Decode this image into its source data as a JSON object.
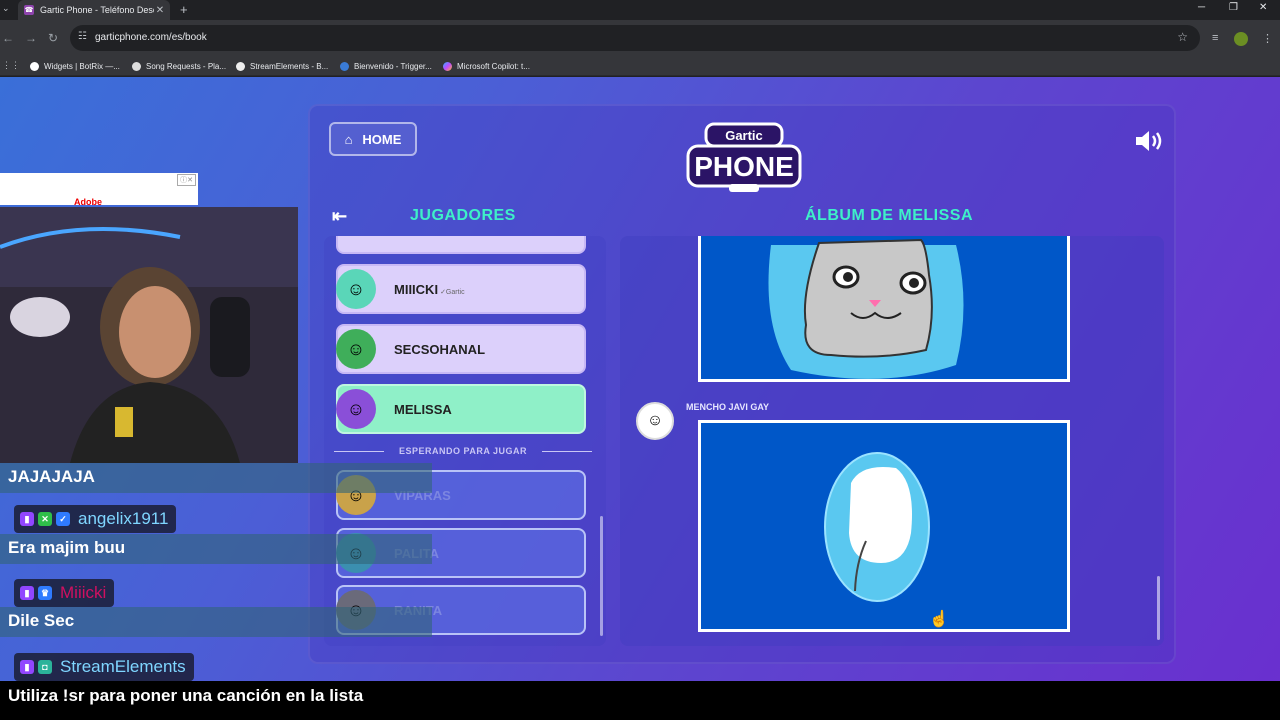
{
  "browser": {
    "tab_title": "Gartic Phone - Teléfono Descon",
    "url": "garticphone.com/es/book",
    "bookmarks": [
      "Widgets | BotRix —...",
      "Song Requests - Pla...",
      "StreamElements - B...",
      "Bienvenido - Trigger...",
      "Microsoft Copilot: t..."
    ]
  },
  "game": {
    "home_label": "HOME",
    "logo_top": "Gartic",
    "logo_bottom": "PHONE",
    "players_heading": "JUGADORES",
    "album_heading": "ÁLBUM DE MELISSA",
    "players": [
      {
        "name": "MIIICKI",
        "tag": "✓Gartic",
        "state": "active"
      },
      {
        "name": "SECSOHANAL",
        "tag": "",
        "state": "active"
      },
      {
        "name": "MELISSA",
        "tag": "",
        "state": "selected"
      }
    ],
    "waiting_label": "ESPERANDO PARA JUGAR",
    "waiting_players": [
      "VIPARAS",
      "PALITA",
      "RANITA"
    ],
    "album_author": "MENCHO JAVI GAY"
  },
  "overlay": {
    "chat": [
      {
        "type": "text",
        "text": "JAJAJAJA"
      },
      {
        "type": "user",
        "name": "angelix1911",
        "color": "#7fd6ff"
      },
      {
        "type": "text",
        "text": "Era majim buu"
      },
      {
        "type": "user",
        "name": "Miiicki",
        "color": "#d01060"
      },
      {
        "type": "text",
        "text": "Dile Sec"
      },
      {
        "type": "user",
        "name": "StreamElements",
        "color": "#7fd6ff"
      }
    ],
    "caption": "Utiliza !sr para poner una canción en la lista",
    "ad_text": "Adobe"
  },
  "colors": {
    "accent_teal": "#3ef0c8",
    "selected_player": "#8ff0c8",
    "drawing_bg": "#0057c8"
  }
}
